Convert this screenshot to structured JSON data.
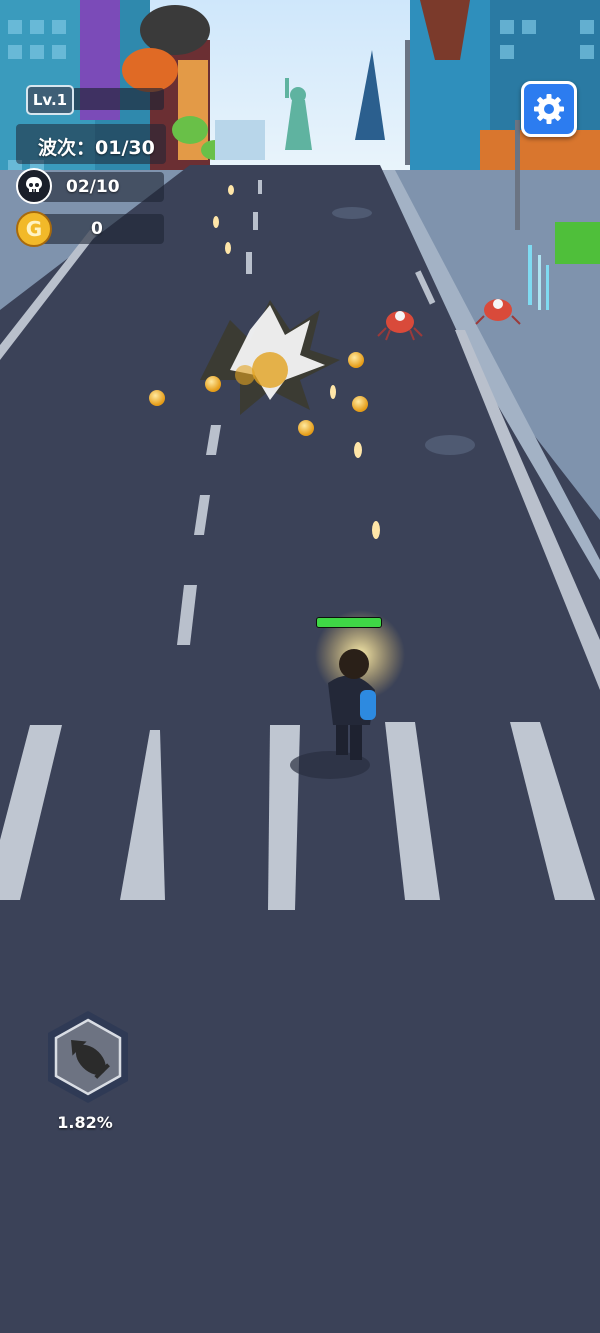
{
  "hud": {
    "level": "Lv.1",
    "wave_text": "波次：01/30",
    "kills": "02/10",
    "coins": "0"
  },
  "skill": {
    "name": "bomb",
    "charge_percent": "1.82%"
  },
  "player": {
    "health_fraction": 1.0
  },
  "colors": {
    "road": "#3b4258",
    "sidewalk": "#7f93ad",
    "settings_button": "#2c7cf0",
    "health": "#3fd746",
    "coin": "#f2b929"
  },
  "icons": {
    "kills": "skull-icon",
    "coins": "coin-icon",
    "settings": "gear-icon",
    "skill": "bomb-icon"
  }
}
